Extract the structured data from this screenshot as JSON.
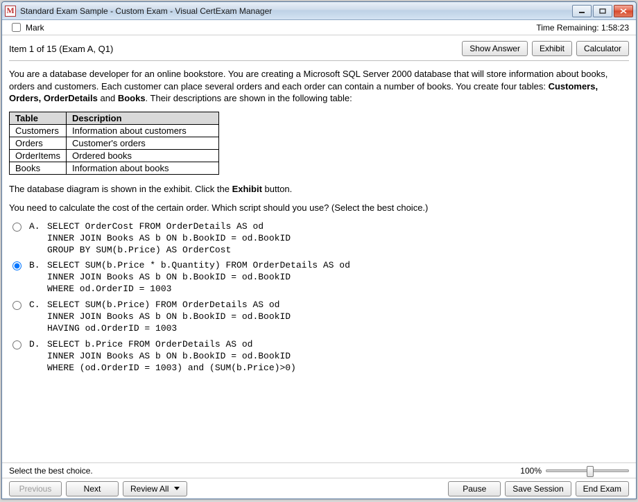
{
  "window": {
    "title": "Standard Exam Sample - Custom Exam - Visual CertExam Manager",
    "icon_letter": "M"
  },
  "mark_row": {
    "label": "Mark",
    "time_label": "Time Remaining: 1:58:23"
  },
  "header": {
    "item_label": "Item 1 of 15  (Exam A, Q1)",
    "show_answer": "Show Answer",
    "exhibit": "Exhibit",
    "calculator": "Calculator"
  },
  "question": {
    "intro_prefix": "You are a database developer for an online bookstore. You are creating a Microsoft SQL Server 2000 database that will store information about books, orders and customers. Each customer can place several orders and each order can contain a number of books. You create four tables: ",
    "bold_tables": "Customers, Orders, OrderDetails",
    "intro_mid": " and ",
    "bold_books": "Books",
    "intro_suffix": ". Their descriptions are shown in the following table:",
    "table_headers": {
      "c1": "Table",
      "c2": "Description"
    },
    "table_rows": [
      {
        "c1": "Customers",
        "c2": "Information about customers"
      },
      {
        "c1": "Orders",
        "c2": "Customer's orders"
      },
      {
        "c1": "OrderItems",
        "c2": "Ordered books"
      },
      {
        "c1": "Books",
        "c2": "Information about books"
      }
    ],
    "exhibit_line_prefix": "The database diagram is shown in the exhibit. Click the ",
    "exhibit_bold": "Exhibit",
    "exhibit_line_suffix": " button.",
    "prompt": "You need to calculate the cost of the certain order. Which script should you use? (Select the best choice.)"
  },
  "choices": [
    {
      "letter": "A.",
      "code": "SELECT OrderCost FROM OrderDetails AS od\nINNER JOIN Books AS b ON b.BookID = od.BookID\nGROUP BY SUM(b.Price) AS OrderCost",
      "checked": false
    },
    {
      "letter": "B.",
      "code": "SELECT SUM(b.Price * b.Quantity) FROM OrderDetails AS od\nINNER JOIN Books AS b ON b.BookID = od.BookID\nWHERE od.OrderID = 1003",
      "checked": true
    },
    {
      "letter": "C.",
      "code": "SELECT SUM(b.Price) FROM OrderDetails AS od\nINNER JOIN Books AS b ON b.BookID = od.BookID\nHAVING od.OrderID = 1003",
      "checked": false
    },
    {
      "letter": "D.",
      "code": "SELECT b.Price FROM OrderDetails AS od\nINNER JOIN Books AS b ON b.BookID = od.BookID\nWHERE (od.OrderID = 1003) and (SUM(b.Price)>0)",
      "checked": false
    }
  ],
  "footer": {
    "instruction": "Select the best choice.",
    "zoom_pct": "100%"
  },
  "bottom": {
    "previous": "Previous",
    "next": "Next",
    "review_all": "Review All",
    "pause": "Pause",
    "save_session": "Save Session",
    "end_exam": "End Exam"
  }
}
